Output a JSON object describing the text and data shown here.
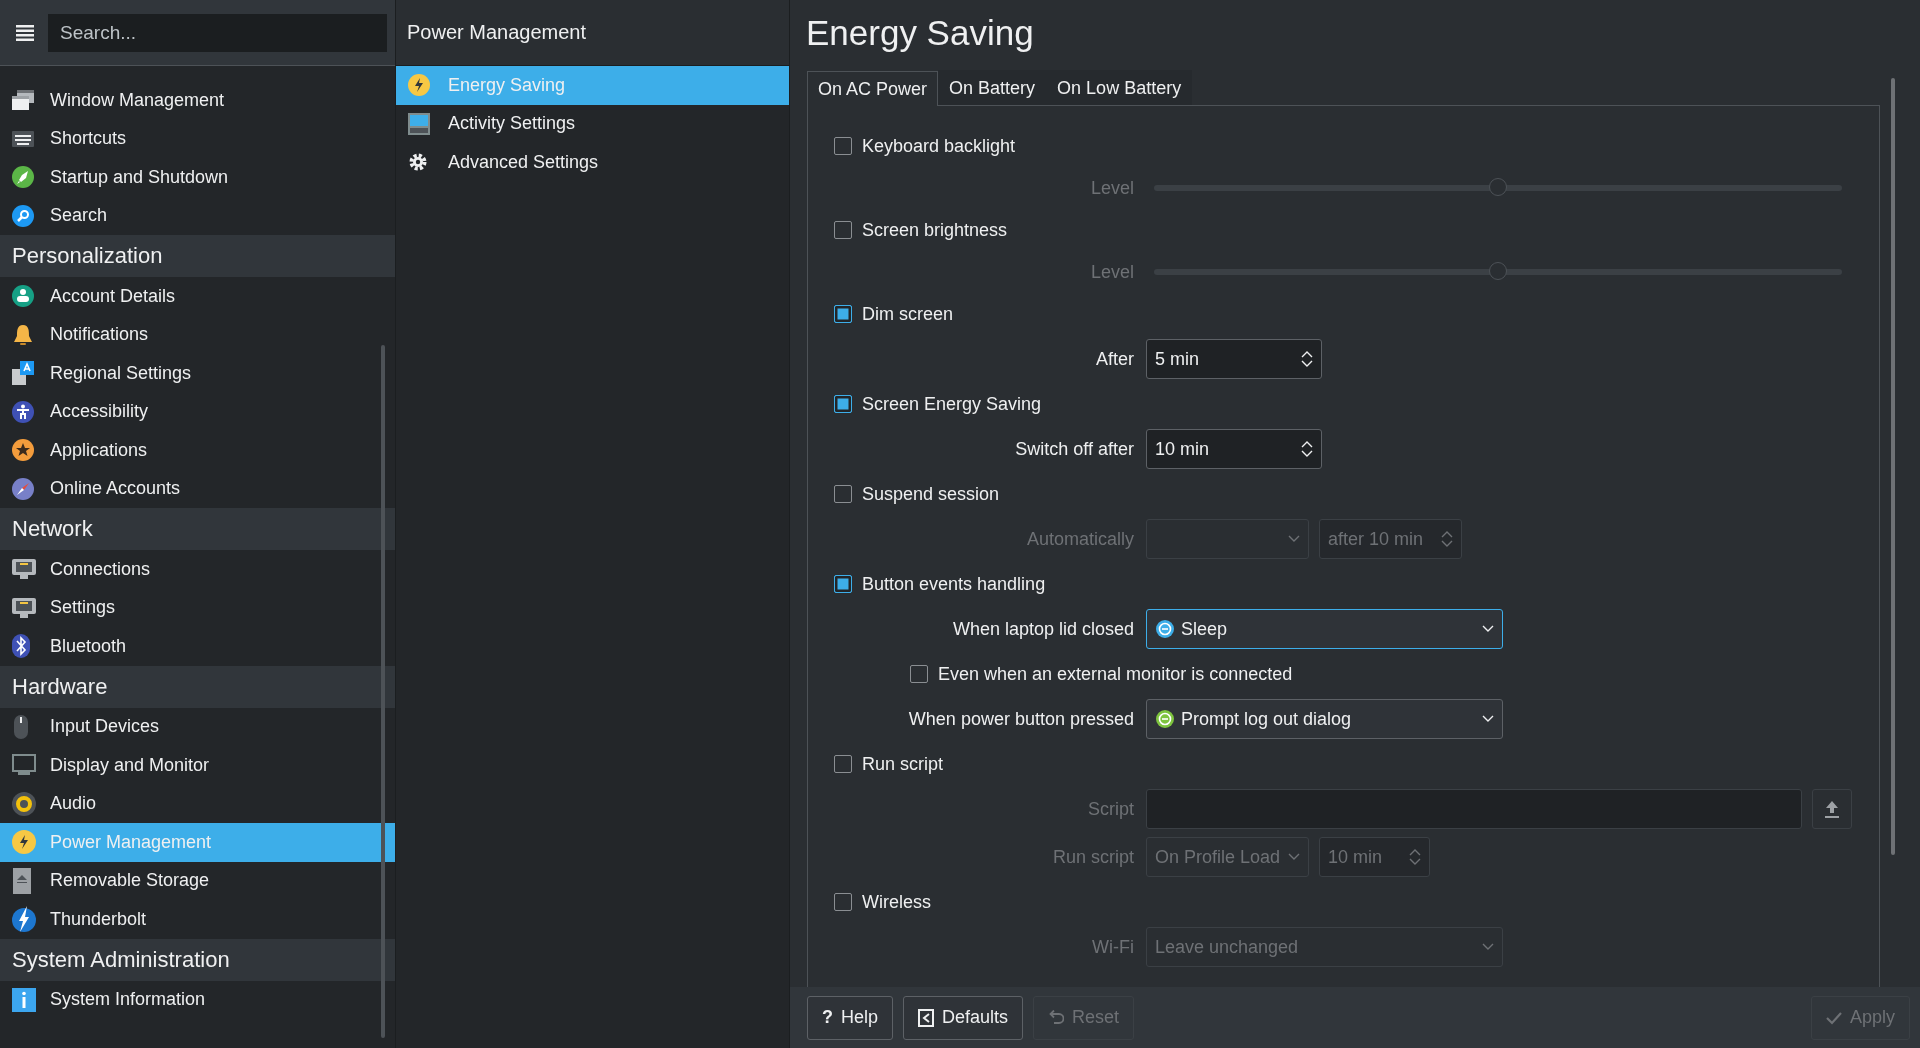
{
  "sidebar": {
    "search": {
      "placeholder": "Search..."
    },
    "sections": [
      {
        "items": [
          {
            "label": "Window Management",
            "selected": false
          },
          {
            "label": "Shortcuts",
            "selected": false
          },
          {
            "label": "Startup and Shutdown",
            "selected": false
          },
          {
            "label": "Search",
            "selected": false
          }
        ]
      },
      {
        "heading": "Personalization",
        "items": [
          {
            "label": "Account Details",
            "selected": false
          },
          {
            "label": "Notifications",
            "selected": false
          },
          {
            "label": "Regional Settings",
            "selected": false
          },
          {
            "label": "Accessibility",
            "selected": false
          },
          {
            "label": "Applications",
            "selected": false
          },
          {
            "label": "Online Accounts",
            "selected": false
          }
        ]
      },
      {
        "heading": "Network",
        "items": [
          {
            "label": "Connections",
            "selected": false
          },
          {
            "label": "Settings",
            "selected": false
          },
          {
            "label": "Bluetooth",
            "selected": false
          }
        ]
      },
      {
        "heading": "Hardware",
        "items": [
          {
            "label": "Input Devices",
            "selected": false
          },
          {
            "label": "Display and Monitor",
            "selected": false
          },
          {
            "label": "Audio",
            "selected": false
          },
          {
            "label": "Power Management",
            "selected": true
          },
          {
            "label": "Removable Storage",
            "selected": false
          },
          {
            "label": "Thunderbolt",
            "selected": false
          }
        ]
      },
      {
        "heading": "System Administration",
        "items": [
          {
            "label": "System Information",
            "selected": false
          }
        ]
      }
    ]
  },
  "module": {
    "title": "Power Management",
    "items": [
      {
        "label": "Energy Saving",
        "selected": true
      },
      {
        "label": "Activity Settings",
        "selected": false
      },
      {
        "label": "Advanced Settings",
        "selected": false
      }
    ]
  },
  "page": {
    "title": "Energy Saving",
    "tabs": [
      {
        "label": "On AC Power",
        "selected": true
      },
      {
        "label": "On Battery",
        "selected": false
      },
      {
        "label": "On Low Battery",
        "selected": false
      }
    ],
    "settings": [
      {
        "kind": "checkbox",
        "label": "Keyboard backlight",
        "checked": false
      },
      {
        "kind": "slider",
        "label": "Level",
        "level": 0.5,
        "disabled": true
      },
      {
        "kind": "checkbox",
        "label": "Screen brightness",
        "checked": false
      },
      {
        "kind": "slider",
        "label": "Level",
        "level": 0.5,
        "disabled": true
      },
      {
        "kind": "checkbox",
        "label": "Dim screen",
        "checked": true
      },
      {
        "kind": "controls",
        "label": "After",
        "disabled": false,
        "controls": [
          {
            "kind": "spinbox",
            "value": "5 min"
          }
        ]
      },
      {
        "kind": "checkbox",
        "label": "Screen Energy Saving",
        "checked": true
      },
      {
        "kind": "controls",
        "label": "Switch off after",
        "disabled": false,
        "controls": [
          {
            "kind": "spinbox",
            "value": "10 min"
          }
        ]
      },
      {
        "kind": "checkbox",
        "label": "Suspend session",
        "checked": false
      },
      {
        "kind": "controls",
        "label": "Automatically",
        "disabled": true,
        "controls": [
          {
            "kind": "combo",
            "focused": false
          },
          {
            "kind": "spinbox",
            "value": "after 10 min"
          }
        ]
      },
      {
        "kind": "checkbox",
        "label": "Button events handling",
        "checked": true
      },
      {
        "kind": "controls",
        "label": "When laptop lid closed",
        "disabled": false,
        "controls": [
          {
            "kind": "combo",
            "value": "Sleep",
            "color": "#3daee9",
            "focused": true
          }
        ]
      },
      {
        "kind": "indented_checkbox",
        "label": "Even when an external monitor is connected",
        "checked": false
      },
      {
        "kind": "controls",
        "label": "When power button pressed",
        "disabled": false,
        "controls": [
          {
            "kind": "combo",
            "value": "Prompt log out dialog",
            "color": "#7ec43f",
            "focused": false
          }
        ]
      },
      {
        "kind": "checkbox",
        "label": "Run script",
        "checked": false
      },
      {
        "kind": "controls",
        "label": "Script",
        "disabled": true,
        "controls": [
          {
            "kind": "file_field"
          }
        ]
      },
      {
        "kind": "controls",
        "label": "Run script",
        "disabled": true,
        "controls": [
          {
            "kind": "combo",
            "value": "On Profile Load",
            "focused": false
          },
          {
            "kind": "spinbox",
            "value": "10 min"
          }
        ]
      },
      {
        "kind": "checkbox",
        "label": "Wireless",
        "checked": false
      },
      {
        "kind": "controls",
        "label": "Wi-Fi",
        "disabled": true,
        "controls": [
          {
            "kind": "combo",
            "value": "Leave unchanged",
            "focused": false
          }
        ]
      }
    ]
  },
  "footer": {
    "left_buttons": [
      {
        "kind": "help",
        "glyph": "?",
        "label": "Help",
        "disabled": false
      },
      {
        "kind": "defaults",
        "label": "Defaults",
        "disabled": false
      },
      {
        "kind": "reset",
        "label": "Reset",
        "disabled": true
      }
    ],
    "right_buttons": [
      {
        "kind": "apply",
        "label": "Apply",
        "disabled": true
      }
    ]
  }
}
